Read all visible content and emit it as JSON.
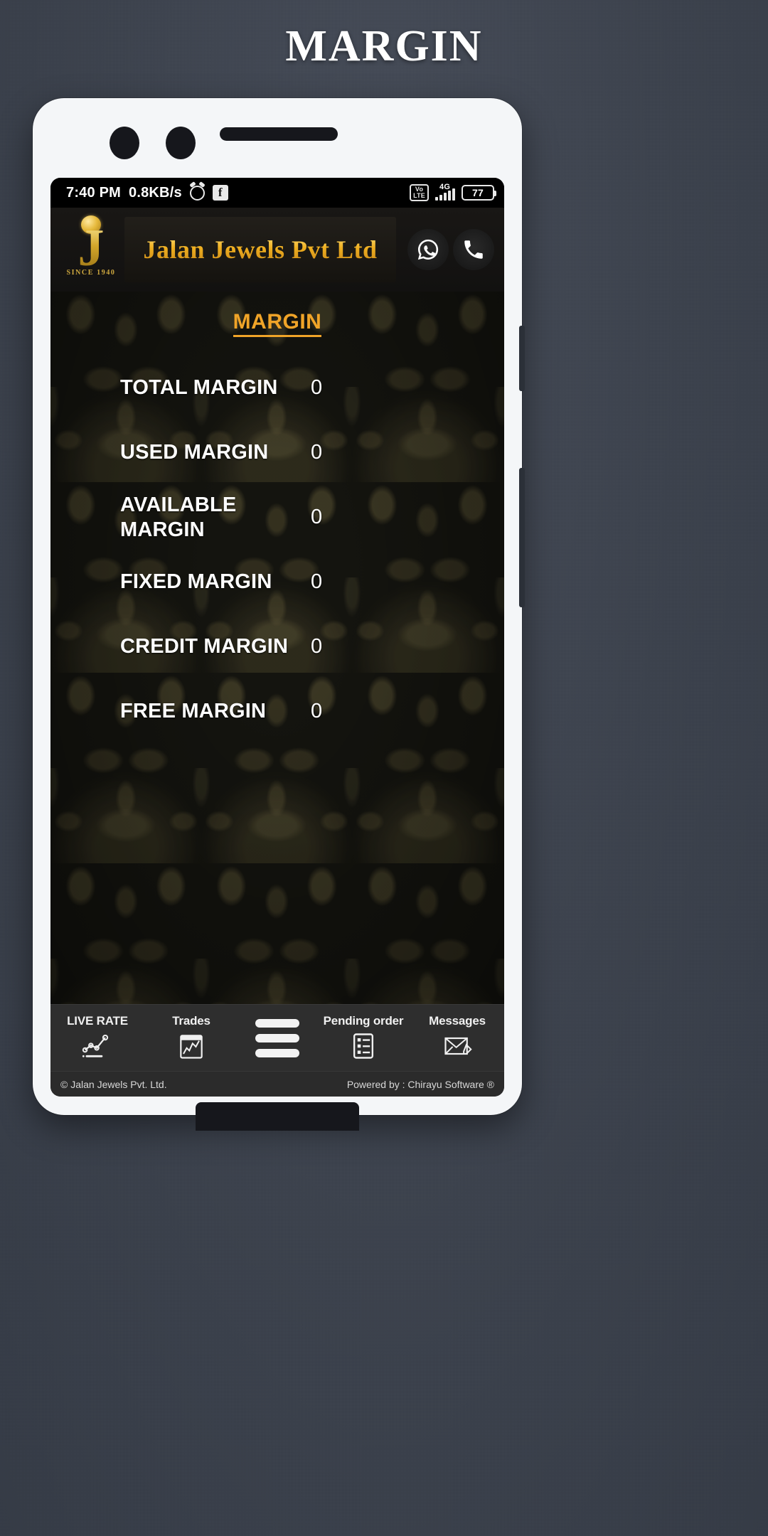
{
  "page": {
    "title": "MARGIN"
  },
  "status_bar": {
    "time": "7:40 PM",
    "net_speed": "0.8KB/s",
    "alarm_icon": "alarm-clock-icon",
    "facebook_icon": "facebook-icon",
    "volte_line1": "Vo",
    "volte_line2": "LTE",
    "network_type": "4G",
    "battery_percent": "77"
  },
  "app_header": {
    "logo_letter": "J",
    "logo_since": "SINCE 1940",
    "brand": "Jalan Jewels Pvt Ltd",
    "whatsapp_icon": "whatsapp-icon",
    "call_icon": "phone-call-icon"
  },
  "main": {
    "section_title": "MARGIN",
    "rows": [
      {
        "label": "TOTAL MARGIN",
        "value": "0"
      },
      {
        "label": "USED MARGIN",
        "value": "0"
      },
      {
        "label": "AVAILABLE MARGIN",
        "value": "0"
      },
      {
        "label": "FIXED MARGIN",
        "value": "0"
      },
      {
        "label": "CREDIT MARGIN",
        "value": "0"
      },
      {
        "label": "FREE MARGIN",
        "value": "0"
      }
    ]
  },
  "bottom_nav": {
    "items": [
      {
        "label": "LIVE RATE",
        "icon": "line-chart-icon"
      },
      {
        "label": "Trades",
        "icon": "trade-chart-icon"
      },
      {
        "label": "",
        "icon": "hamburger-menu-icon"
      },
      {
        "label": "Pending order",
        "icon": "pending-order-list-icon"
      },
      {
        "label": "Messages",
        "icon": "message-envelope-icon"
      }
    ]
  },
  "footer": {
    "copyright": "© Jalan Jewels Pvt. Ltd.",
    "powered_by": "Powered by : Chirayu Software ®"
  },
  "colors": {
    "page_bg": "#3d434e",
    "accent_gold": "#f0a428",
    "brand_gold": "#efae1f",
    "screen_bg": "#14140f",
    "nav_bg": "#2e2e2e"
  }
}
